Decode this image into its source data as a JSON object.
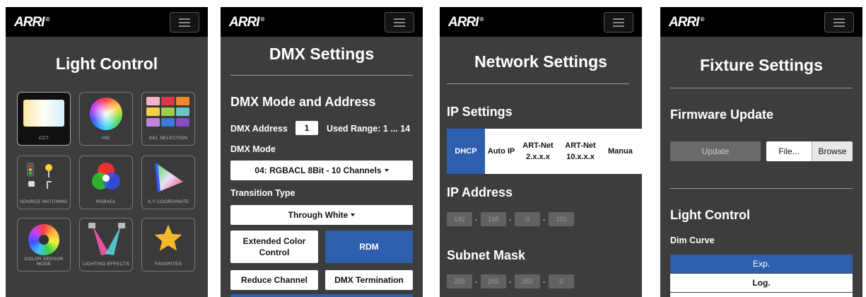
{
  "brand": "ARRI",
  "screens": {
    "light": {
      "title": "Light Control",
      "tiles": [
        {
          "label": "CCT",
          "icon": "cct-gradient-icon"
        },
        {
          "label": "HSI",
          "icon": "color-wheel-icon"
        },
        {
          "label": "GEL SELECTION",
          "icon": "gel-swatches-icon"
        },
        {
          "label": "SOURCE MATCHING",
          "icon": "source-matching-icon"
        },
        {
          "label": "RGBACL",
          "icon": "rgb-circles-icon"
        },
        {
          "label": "X,Y COORDINATE",
          "icon": "xy-triangle-icon"
        },
        {
          "label": "COLOR SENSOR MODE",
          "icon": "color-sensor-icon"
        },
        {
          "label": "LIGHTING EFFECTS",
          "icon": "lighting-effects-icon"
        },
        {
          "label": "FAVORITES",
          "icon": "star-icon"
        }
      ]
    },
    "dmx": {
      "title": "DMX Settings",
      "section": "DMX Mode and Address",
      "address_label": "DMX Address",
      "address_value": "1",
      "used_range": "Used Range: 1 ... 14",
      "mode_label": "DMX Mode",
      "mode_value": "04: RGBACL 8Bit - 10 Channels",
      "transition_label": "Transition Type",
      "transition_value": "Through White",
      "btn_extended": "Extended Color Control",
      "btn_rdm": "RDM",
      "btn_reduce": "Reduce Channel",
      "btn_termination": "DMX Termination"
    },
    "network": {
      "title": "Network Settings",
      "ip_settings": "IP Settings",
      "modes": [
        "DHCP",
        "Auto IP",
        "ART-Net 2.x.x.x",
        "ART-Net 10.x.x.x",
        "Manua"
      ],
      "ip_address_label": "IP Address",
      "ip_address": [
        "192",
        "168",
        "0",
        "101"
      ],
      "subnet_label": "Subnet Mask",
      "subnet": [
        "255",
        "255",
        "255",
        "0"
      ]
    },
    "fixture": {
      "title": "Fixture Settings",
      "firmware": "Firmware Update",
      "update_btn": "Update",
      "file_btn": "File...",
      "browse_btn": "Browse",
      "light_control": "Light Control",
      "dim_curve": "Dim Curve",
      "curves": [
        "Exp.",
        "Log."
      ]
    }
  },
  "colors": {
    "accent": "#2e5fae",
    "panel": "#3d3d3d",
    "topbar": "#000000"
  }
}
